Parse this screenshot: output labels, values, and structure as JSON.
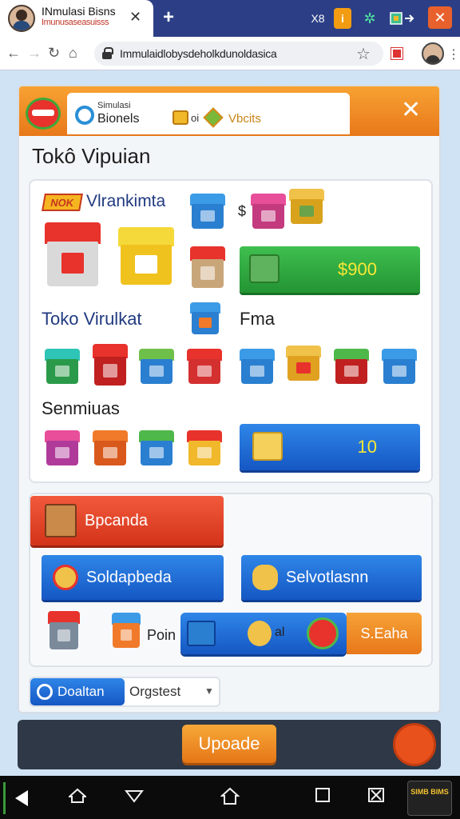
{
  "browser": {
    "tab_title": "INmulasi Bisns",
    "tab_subtitle": "Imunusaseasuisss",
    "tab_close": "✕",
    "new_tab": "+",
    "ext_text": "X8",
    "ext_orange": "i",
    "url": "Immulaidlobysdeholkdunoldasica",
    "window_close": "✕"
  },
  "game": {
    "header": {
      "tab_title_small": "Simulasi",
      "tab_title": "Bionels",
      "currency_label": "oi",
      "vbucks_label": "Vbcits",
      "close": "✕"
    },
    "shop_title": "Tokô Vipuian",
    "section_new": {
      "badge": "NOK",
      "title": "Vlrankimta",
      "currency_symbol": "$",
      "buy_price": "$900"
    },
    "section_virtual": {
      "title": "Toko Virulkat",
      "extra_label": "Fma"
    },
    "section_services": {
      "title": "Senmiuas",
      "buy_price": "10"
    },
    "actions": {
      "red_button": "Bpcanda",
      "blue_button_1": "Soldapbeda",
      "blue_button_2": "Selvotlasnn",
      "poin_label": "Poin",
      "pill_label": "al",
      "orange_button": "S.Eaha"
    },
    "select": {
      "button": "Doaltan",
      "value": "Orgstest"
    },
    "upgrade_button": "Upoade"
  },
  "system_nav": {
    "promo_text": "SIMB BIMS"
  },
  "colors": {
    "orange": "#e8781a",
    "blue": "#1557c4",
    "green": "#239433",
    "red": "#d33319",
    "price_yellow": "#f7e836"
  },
  "icons": [
    "user-avatar",
    "lock-icon",
    "star-icon",
    "close-icon",
    "store-icon",
    "cart-icon",
    "coin-icon",
    "gem-icon"
  ]
}
